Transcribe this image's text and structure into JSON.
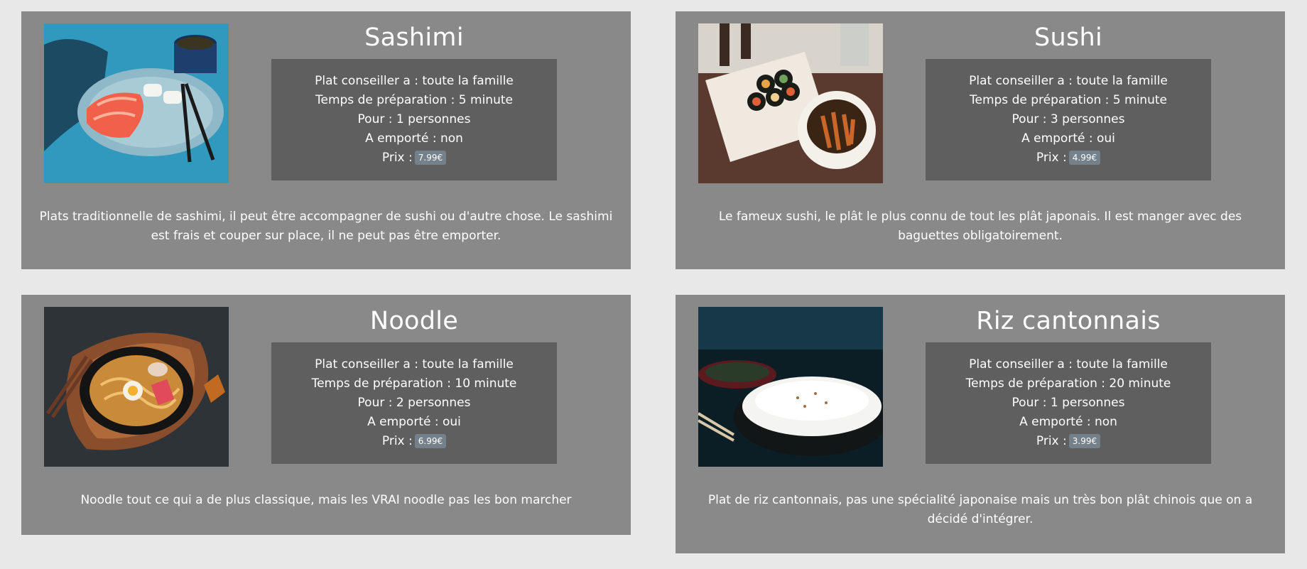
{
  "cards": [
    {
      "title": "Sashimi",
      "image_icon": "sashimi-photo",
      "recommended": "Plat conseiller a : toute la famille",
      "prep_time": "Temps de préparation : 5 minute",
      "servings": "Pour : 1 personnes",
      "takeaway": "A emporté : non",
      "price_label": "Prix :",
      "price": "7.99€",
      "description": "Plats traditionnelle de sashimi, il peut être accompagner de sushi ou d'autre chose. Le sashimi est frais et couper sur place, il ne peut pas être emporter."
    },
    {
      "title": "Sushi",
      "image_icon": "sushi-photo",
      "recommended": "Plat conseiller a : toute la famille",
      "prep_time": "Temps de préparation : 5 minute",
      "servings": "Pour : 3 personnes",
      "takeaway": "A emporté : oui",
      "price_label": "Prix :",
      "price": "4.99€",
      "description": "Le fameux sushi, le plât le plus connu de tout les plât japonais. Il est manger avec des baguettes obligatoirement."
    },
    {
      "title": "Noodle",
      "image_icon": "noodle-photo",
      "recommended": "Plat conseiller a : toute la famille",
      "prep_time": "Temps de préparation : 10 minute",
      "servings": "Pour : 2 personnes",
      "takeaway": "A emporté : oui",
      "price_label": "Prix :",
      "price": "6.99€",
      "description": "Noodle tout ce qui a de plus classique, mais les VRAI noodle pas les bon marcher"
    },
    {
      "title": "Riz cantonnais",
      "image_icon": "rice-photo",
      "recommended": "Plat conseiller a : toute la famille",
      "prep_time": "Temps de préparation : 20 minute",
      "servings": "Pour : 1 personnes",
      "takeaway": "A emporté : non",
      "price_label": "Prix :",
      "price": "3.99€",
      "description": "Plat de riz cantonnais, pas une spécialité japonaise mais un très bon plât chinois que on a décidé d'intégrer."
    }
  ],
  "colors": {
    "page_bg": "#e8e8e8",
    "card_bg": "#898989",
    "info_box_bg": "#5f5f5f",
    "price_badge_bg": "#74808a",
    "text": "#ffffff"
  }
}
